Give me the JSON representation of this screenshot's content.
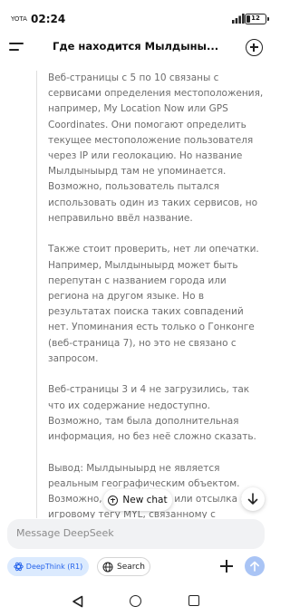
{
  "status_bar": {
    "carrier": "YOTA",
    "time": "02:24",
    "network": "4G",
    "battery": "12"
  },
  "header": {
    "menu_icon": "hamburger-menu-icon",
    "title": "Где находится Мылдыны...",
    "new_chat_icon": "plus-circle-icon"
  },
  "conversation": {
    "paragraphs": [
      "Веб-страницы с 5 по 10 связаны с сервисами определения местоположения, например, My Location Now или GPS Coordinates. Они помогают определить текущее местоположение пользователя через IP или геолокацию. Но название Мылдыныырд там не упоминается. Возможно, пользователь пытался использовать один из таких сервисов, но неправильно ввёл название.",
      "Также стоит проверить, нет ли опечатки. Например, Мылдыныырд может быть перепутан с названием города или региона на другом языке. Но в результатах поиска таких совпадений нет. Упоминания есть только о Гонконге (веб-страница 7), но это не связано с запросом.",
      "Веб-страницы 3 и 4 не загрузились, так что их содержание недоступно. Возможно, там была дополнительная информация, но без неё сложно сказать.",
      "Вывод: Мылдыныырд не является реальным географическим объектом. Возможно, это опечатка или отсылка к игровому тегу MYL, связанному с китайским игроком FUZELAI ... именем. Нужно"
    ]
  },
  "overlay": {
    "new_chat_label": "New chat",
    "new_chat_icon": "plus-circle-icon",
    "scroll_icon": "arrow-down-icon"
  },
  "composer": {
    "placeholder": "Message DeepSeek",
    "deepthink_label": "DeepThink (R1)",
    "deepthink_icon": "deepthink-atom-icon",
    "search_label": "Search",
    "search_icon": "globe-icon",
    "attach_icon": "plus-icon",
    "send_icon": "arrow-up-icon"
  },
  "colors": {
    "accent": "#2563eb",
    "deepthink_bg": "#dbeafe",
    "send_disabled": "#a9c4f5",
    "thinking_text": "#6d6d6d"
  },
  "nav_bar": {
    "back_icon": "triangle-back-icon",
    "home_icon": "circle-home-icon",
    "recents_icon": "square-recents-icon"
  }
}
